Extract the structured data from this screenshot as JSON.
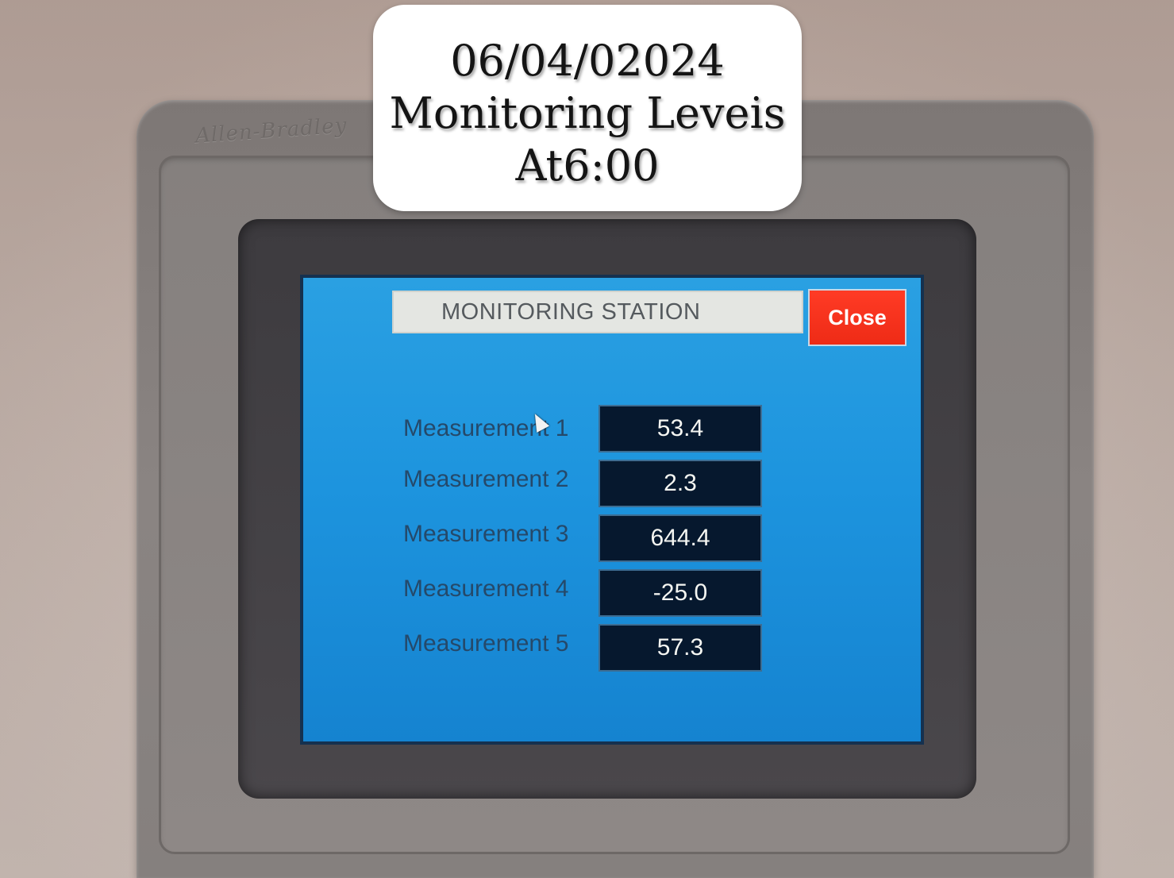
{
  "caption": {
    "date": "06/04/02024",
    "title": "Monitoring Leveis",
    "time": "At6:00"
  },
  "device": {
    "brand": "Allen-Bradley"
  },
  "hmi": {
    "title": "MONITORING STATION",
    "close_label": "Close",
    "measurements": [
      {
        "label": "Measurement 1",
        "value": "53.4"
      },
      {
        "label": "Measurement 2",
        "value": "2.3"
      },
      {
        "label": "Measurement 3",
        "value": "644.4"
      },
      {
        "label": "Measurement 4",
        "value": "-25.0"
      },
      {
        "label": "Measurement 5",
        "value": "57.3"
      }
    ]
  },
  "colors": {
    "screen_blue": "#1d94de",
    "close_red": "#ee2b16",
    "value_box": "#06182e",
    "label_text": "#25496a"
  }
}
